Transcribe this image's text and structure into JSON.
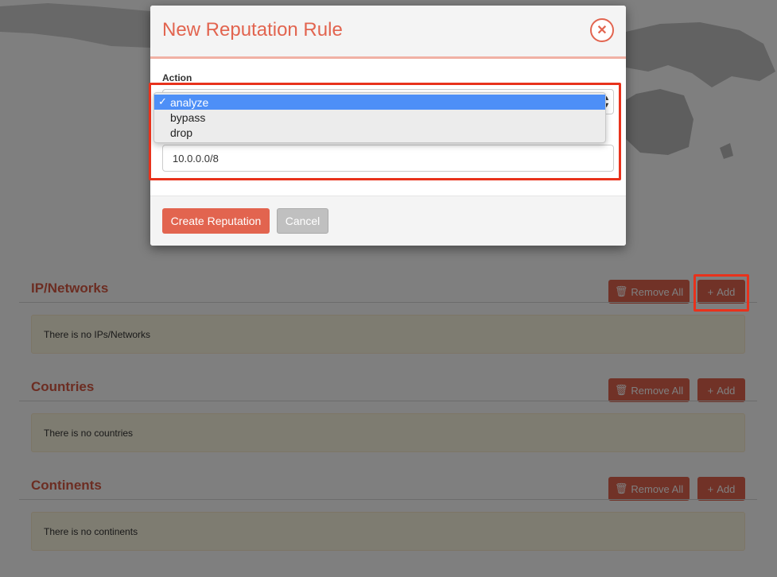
{
  "modal": {
    "title": "New Reputation Rule",
    "close_icon": "close-icon",
    "action_label": "Action",
    "action_select": {
      "selected": "analyze",
      "options": [
        "analyze",
        "bypass",
        "drop"
      ]
    },
    "network_value": "10.0.0.0/8",
    "create_label": "Create Reputation",
    "cancel_label": "Cancel"
  },
  "sections": [
    {
      "title": "IP/Networks",
      "remove_label": "Remove All",
      "add_label": "Add",
      "empty_text": "There is no IPs/Networks"
    },
    {
      "title": "Countries",
      "remove_label": "Remove All",
      "add_label": "Add",
      "empty_text": "There is no countries"
    },
    {
      "title": "Continents",
      "remove_label": "Remove All",
      "add_label": "Add",
      "empty_text": "There is no continents"
    }
  ],
  "icons": {
    "trash": "trash-icon",
    "plus": "plus-icon",
    "check": "checkmark-icon"
  },
  "colors": {
    "accent": "#e2644f",
    "highlight": "#e8321c",
    "selection": "#4d8ff7",
    "warning_bg": "#fcf8e3"
  }
}
